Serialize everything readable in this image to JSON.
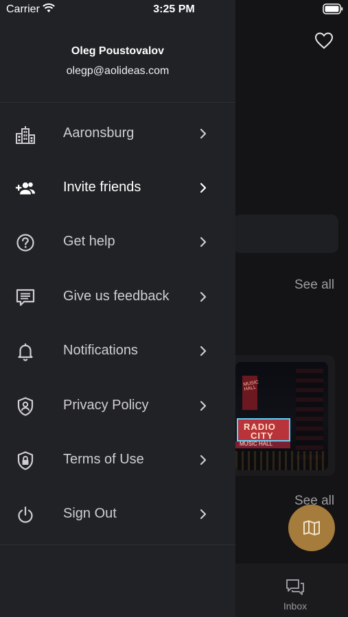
{
  "status_bar": {
    "carrier": "Carrier",
    "time": "3:25 PM"
  },
  "profile": {
    "name": "Oleg Poustovalov",
    "email": "olegp@aolideas.com"
  },
  "menu": {
    "items": [
      {
        "label": "Aaronsburg",
        "icon": "city-buildings-icon"
      },
      {
        "label": "Invite friends",
        "icon": "add-friends-icon"
      },
      {
        "label": "Get help",
        "icon": "help-circle-icon"
      },
      {
        "label": "Give us feedback",
        "icon": "feedback-icon"
      },
      {
        "label": "Notifications",
        "icon": "bell-icon"
      },
      {
        "label": "Privacy Policy",
        "icon": "shield-user-icon"
      },
      {
        "label": "Terms of Use",
        "icon": "shield-lock-icon"
      },
      {
        "label": "Sign Out",
        "icon": "power-icon"
      }
    ]
  },
  "background": {
    "see_all_1": "See all",
    "see_all_2": "See all",
    "photo_sign_line1": "RADIO",
    "photo_sign_line2": "CITY",
    "photo_strip": "MUSIC HALL",
    "photo_tower": "MUSIC HALL",
    "inbox_label": "Inbox"
  },
  "colors": {
    "drawer_bg": "#212226",
    "screen_bg": "#141416",
    "fab_accent": "#a67c3c"
  }
}
